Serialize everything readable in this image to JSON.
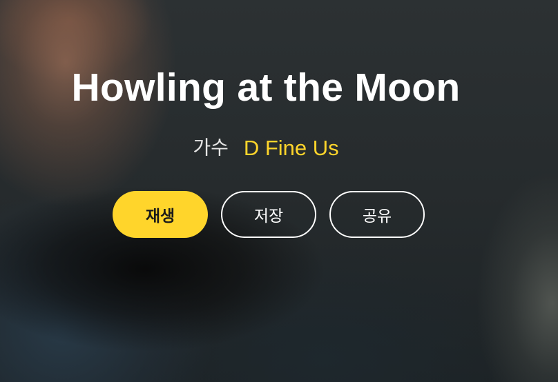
{
  "song": {
    "title": "Howling at the Moon",
    "artist_label": "가수",
    "artist_name": "D Fine Us"
  },
  "actions": {
    "play_label": "재생",
    "save_label": "저장",
    "share_label": "공유"
  },
  "colors": {
    "accent": "#ffd52b",
    "text": "#ffffff"
  }
}
